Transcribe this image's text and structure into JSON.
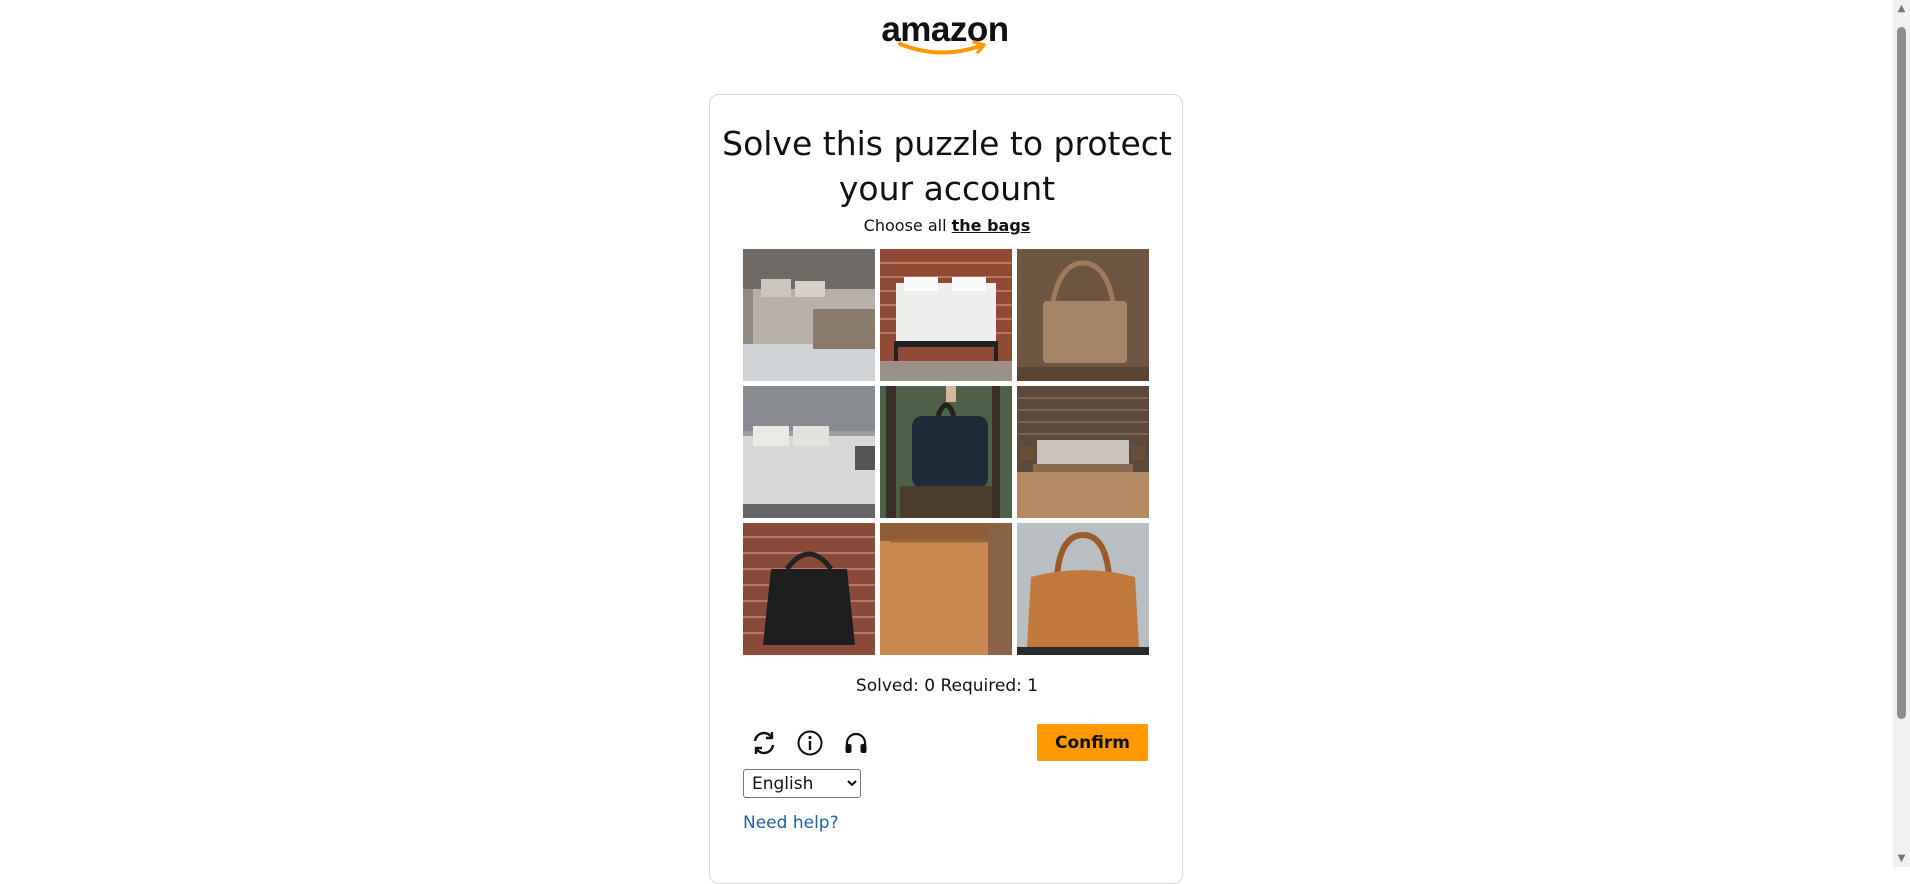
{
  "brand": {
    "logo_text": "amazon",
    "accent_color": "#ff9900"
  },
  "puzzle": {
    "title": "Solve this puzzle to protect your account",
    "instruction_prefix": "Choose all",
    "instruction_target": "the bags",
    "tiles": [
      {
        "id": 1,
        "subject": "bedroom"
      },
      {
        "id": 2,
        "subject": "bed"
      },
      {
        "id": 3,
        "subject": "bag"
      },
      {
        "id": 4,
        "subject": "bedroom"
      },
      {
        "id": 5,
        "subject": "bag"
      },
      {
        "id": 6,
        "subject": "bed"
      },
      {
        "id": 7,
        "subject": "bag"
      },
      {
        "id": 8,
        "subject": "bag"
      },
      {
        "id": 9,
        "subject": "bag"
      }
    ],
    "status_text": "Solved: 0 Required: 1",
    "icons": [
      "refresh-icon",
      "info-icon",
      "audio-icon"
    ],
    "confirm_label": "Confirm",
    "language_selected": "English",
    "help_link": "Need help?"
  },
  "colors": {
    "confirm_bg": "#ff9900",
    "link": "#2162a1",
    "card_border": "#d5d9d9"
  }
}
